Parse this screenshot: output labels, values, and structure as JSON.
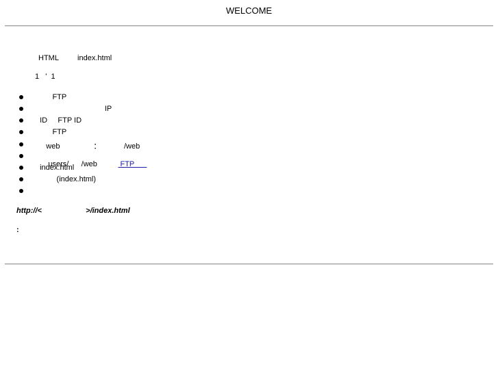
{
  "page": {
    "title": "WELCOME",
    "intro_line1": "HTML         index.html",
    "intro_line2": "1   '  1",
    "list_items": [
      {
        "text": "        FTP"
      },
      {
        "text": "                                 IP"
      },
      {
        "text": "  ID     FTP ID"
      },
      {
        "text": "        FTP"
      },
      {
        "text": "     web                ：           /web"
      },
      {
        "text": "users/      /web          ",
        "link": " FTP      "
      },
      {
        "text": "  index.html"
      },
      {
        "text": "          (index.html)"
      },
      {
        "text": ""
      }
    ],
    "url_line": "http://<                     >/index.html",
    "colon_line": ":"
  }
}
